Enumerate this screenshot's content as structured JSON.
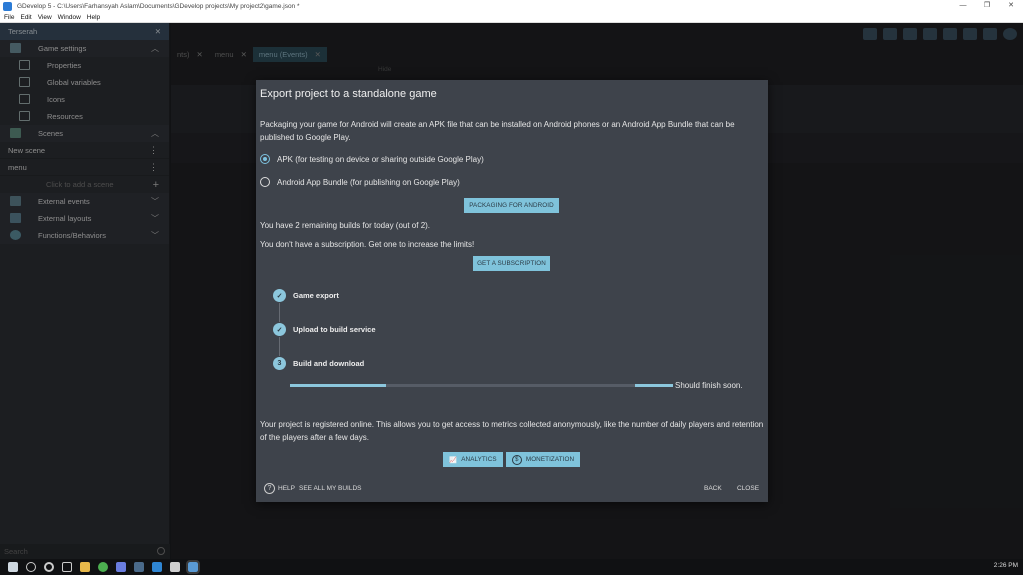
{
  "window": {
    "title": "GDevelop 5 - C:\\Users\\Farhansyah Aslam\\Documents\\GDevelop projects\\My project2\\game.json *",
    "minimize": "—",
    "maximize": "❐",
    "close": "✕"
  },
  "menu": [
    "File",
    "Edit",
    "View",
    "Window",
    "Help"
  ],
  "sidebar": {
    "project_name": "Terserah",
    "game_settings": "Game settings",
    "properties": "Properties",
    "global_variables": "Global variables",
    "icons": "Icons",
    "resources": "Resources",
    "scenes": "Scenes",
    "scene_list": [
      "New scene",
      "menu"
    ],
    "add_scene": "Click to add a scene",
    "external_events": "External events",
    "external_layouts": "External layouts",
    "functions_behaviors": "Functions/Behaviors",
    "search_placeholder": "Search"
  },
  "tabs": [
    {
      "label": "nts)"
    },
    {
      "label": "menu"
    },
    {
      "label": "menu (Events)"
    }
  ],
  "hide_label": "Hide",
  "dialog": {
    "title": "Export project to a standalone game",
    "intro": "Packaging your game for Android will create an APK file that can be installed on Android phones or an Android App Bundle that can be published to Google Play.",
    "option_apk": "APK (for testing on device or sharing outside Google Play)",
    "option_bundle": "Android App Bundle (for publishing on Google Play)",
    "package_button": "PACKAGING FOR ANDROID",
    "remaining_builds": "You have 2 remaining builds for today (out of 2).",
    "no_subscription": "You don't have a subscription. Get one to increase the limits!",
    "subscription_button": "GET A SUBSCRIPTION",
    "steps": [
      {
        "label": "Game export",
        "badge": "✓"
      },
      {
        "label": "Upload to build service",
        "badge": "✓"
      },
      {
        "label": "Build and download",
        "badge": "3"
      }
    ],
    "progress_status": "Should finish soon.",
    "registered_text": "Your project is registered online. This allows you to get access to metrics collected anonymously, like the number of daily players and retention of the players after a few days.",
    "analytics_button": "ANALYTICS",
    "monetization_button": "MONETIZATION",
    "help": "HELP",
    "see_all_builds": "SEE ALL MY BUILDS",
    "back": "BACK",
    "close": "CLOSE"
  },
  "taskbar": {
    "clock": "2:26 PM"
  },
  "colors": {
    "accent": "#7fc3db",
    "dialog_bg": "#3e434b",
    "sidebar_bg": "#2c2e33"
  }
}
